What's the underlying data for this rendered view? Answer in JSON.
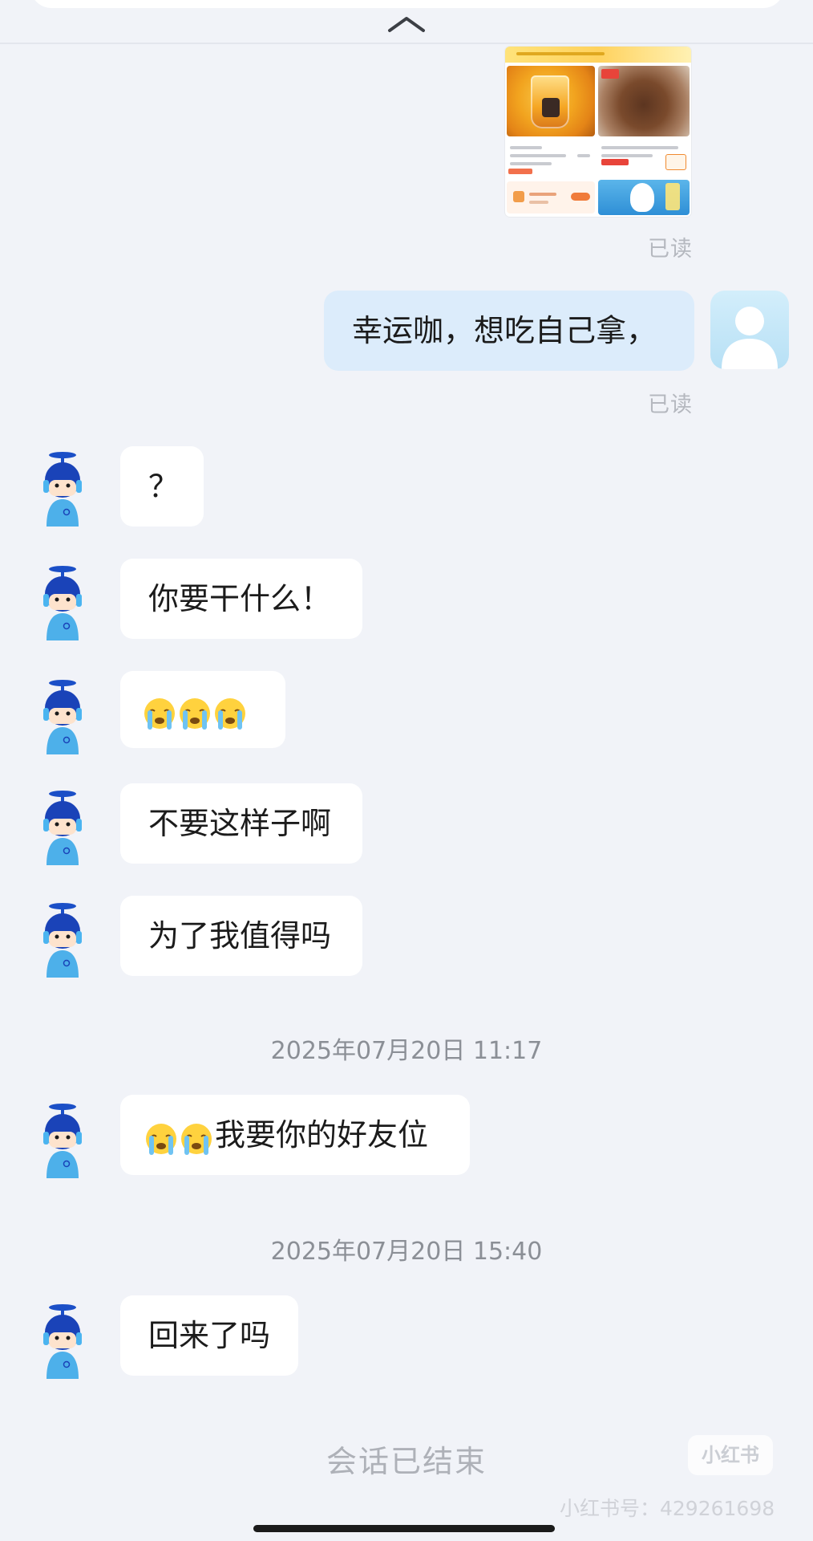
{
  "conversation": {
    "outgoing": [
      {
        "text": "幸运咖，想吃自己拿，",
        "status": "已读"
      }
    ],
    "image_message_status": "已读",
    "incoming": [
      {
        "text": "？"
      },
      {
        "text": "你要干什么！"
      },
      {
        "emoji": [
          "crying-face",
          "crying-face",
          "crying-face"
        ],
        "text": ""
      },
      {
        "text": "不要这样子啊"
      },
      {
        "text": "为了我值得吗"
      },
      {
        "emoji": [
          "crying-face",
          "crying-face"
        ],
        "text": "我要你的好友位"
      },
      {
        "text": "回来了吗"
      }
    ],
    "timestamps": [
      "2025年07月20日 11:17",
      "2025年07月20日 15:40"
    ],
    "session_end": "会话已结束"
  },
  "watermark": {
    "logo": "小红书",
    "id_text": "小红书号：429261698"
  },
  "colors": {
    "background": "#f1f3f8",
    "incoming_bubble": "#ffffff",
    "outgoing_bubble": "#dcecfb",
    "muted_text": "#b5b8bf"
  },
  "icons": {
    "header": "chevron-up-icon",
    "incoming_avatar": "bot-avatar-icon",
    "outgoing_avatar": "user-avatar-icon",
    "emoji": "crying-face-icon"
  }
}
